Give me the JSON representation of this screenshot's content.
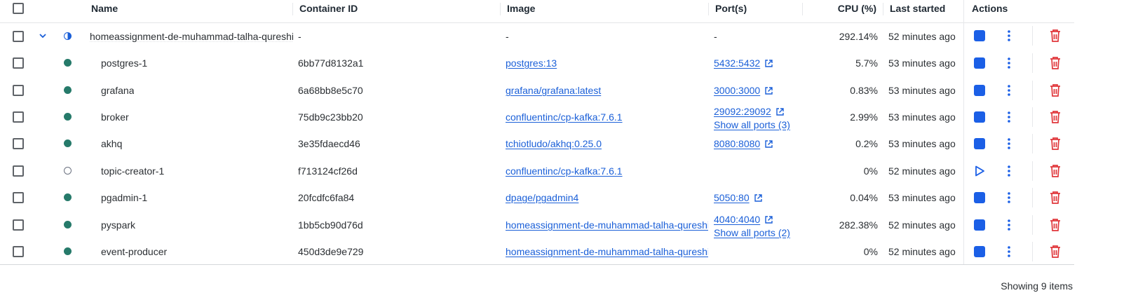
{
  "header": {
    "name": "Name",
    "container_id": "Container ID",
    "image": "Image",
    "ports": "Port(s)",
    "cpu": "CPU (%)",
    "last_started": "Last started",
    "actions": "Actions"
  },
  "group": {
    "name": "homeassignment-de-muhammad-talha-qureshi",
    "container_id": "-",
    "image": "-",
    "ports": "-",
    "cpu": "292.14%",
    "last_started": "52 minutes ago"
  },
  "rows": [
    {
      "name": "postgres-1",
      "status": "running",
      "container_id": "6bb77d8132a1",
      "image": "postgres:13",
      "port": "5432:5432",
      "ports_more": "",
      "cpu": "5.7%",
      "last_started": "53 minutes ago"
    },
    {
      "name": "grafana",
      "status": "running",
      "container_id": "6a68bb8e5c70",
      "image": "grafana/grafana:latest",
      "port": "3000:3000",
      "ports_more": "",
      "cpu": "0.83%",
      "last_started": "53 minutes ago"
    },
    {
      "name": "broker",
      "status": "running",
      "container_id": "75db9c23bb20",
      "image": "confluentinc/cp-kafka:7.6.1",
      "port": "29092:29092",
      "ports_more": "Show all ports (3)",
      "cpu": "2.99%",
      "last_started": "53 minutes ago"
    },
    {
      "name": "akhq",
      "status": "running",
      "container_id": "3e35fdaecd46",
      "image": "tchiotludo/akhq:0.25.0",
      "port": "8080:8080",
      "ports_more": "",
      "cpu": "0.2%",
      "last_started": "53 minutes ago"
    },
    {
      "name": "topic-creator-1",
      "status": "exited",
      "container_id": "f713124cf26d",
      "image": "confluentinc/cp-kafka:7.6.1",
      "port": "",
      "ports_more": "",
      "cpu": "0%",
      "last_started": "52 minutes ago"
    },
    {
      "name": "pgadmin-1",
      "status": "running",
      "container_id": "20fcdfc6fa84",
      "image": "dpage/pgadmin4",
      "port": "5050:80",
      "ports_more": "",
      "cpu": "0.04%",
      "last_started": "53 minutes ago"
    },
    {
      "name": "pyspark",
      "status": "running",
      "container_id": "1bb5cb90d76d",
      "image": "homeassignment-de-muhammad-talha-qureshi",
      "port": "4040:4040",
      "ports_more": "Show all ports (2)",
      "cpu": "282.38%",
      "last_started": "52 minutes ago"
    },
    {
      "name": "event-producer",
      "status": "running",
      "container_id": "450d3de9e729",
      "image": "homeassignment-de-muhammad-talha-qureshi",
      "port": "",
      "ports_more": "",
      "cpu": "0%",
      "last_started": "52 minutes ago"
    }
  ],
  "footer": {
    "showing": "Showing 9 items"
  },
  "icons": {
    "expand": "chevron-down-icon",
    "group_status": "half-circle-status-icon",
    "running": "running-status-icon",
    "exited": "exited-status-icon",
    "stop": "stop-icon",
    "start": "play-icon",
    "more": "kebab-menu-icon",
    "delete": "trash-icon",
    "external": "external-link-icon"
  },
  "colors": {
    "link": "#1a5fd8",
    "running": "#267a6a",
    "stop": "#1b5fe6",
    "delete": "#e0363a"
  }
}
